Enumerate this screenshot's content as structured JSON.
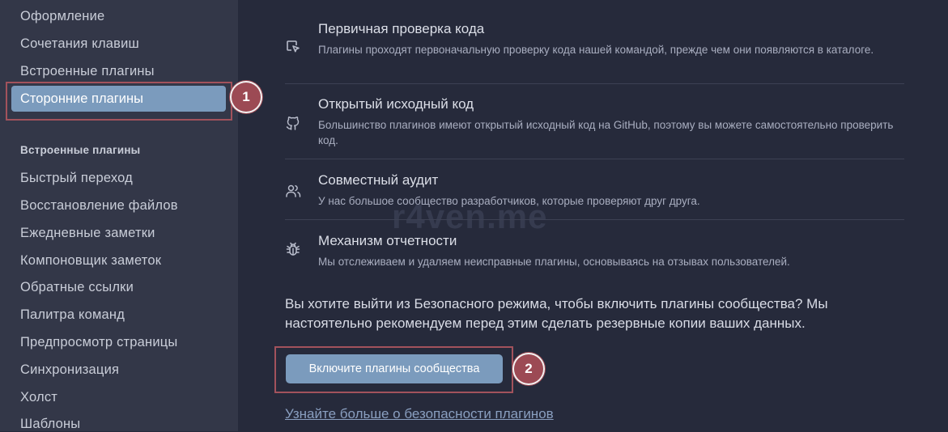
{
  "sidebar": {
    "items_top": [
      "Оформление",
      "Сочетания клавиш",
      "Встроенные плагины"
    ],
    "active_item": "Сторонние плагины",
    "section_title": "Встроенные плагины",
    "items_core": [
      "Быстрый переход",
      "Восстановление файлов",
      "Ежедневные заметки",
      "Компоновщик заметок",
      "Обратные ссылки",
      "Палитра команд",
      "Предпросмотр страницы",
      "Синхронизация",
      "Холст",
      "Шаблоны"
    ]
  },
  "annotations": {
    "badge1": "1",
    "badge2": "2",
    "highlight_color": "#a2525c"
  },
  "features": [
    {
      "icon": "cursor-select-icon",
      "title": "Первичная проверка кода",
      "desc": "Плагины проходят первоначальную проверку кода нашей командой, прежде чем они появляются в каталоге."
    },
    {
      "icon": "github-icon",
      "title": "Открытый исходный код",
      "desc": "Большинство плагинов имеют открытый исходный код на GitHub, поэтому вы можете самостоятельно проверить код."
    },
    {
      "icon": "users-icon",
      "title": "Совместный аудит",
      "desc": "У нас большое сообщество разработчиков, которые проверяют друг друга."
    },
    {
      "icon": "bug-icon",
      "title": "Механизм отчетности",
      "desc": "Мы отслеживаем и удаляем неисправные плагины, основываясь на отзывах пользователей."
    }
  ],
  "question": "Вы хотите выйти из Безопасного режима, чтобы включить плагины сообщества? Мы настоятельно рекомендуем перед этим сделать резервные копии ваших данных.",
  "enable_button": "Включите плагины сообщества",
  "learn_more_link": "Узнайте больше о безопасности плагинов",
  "watermark": "r4ven.me",
  "colors": {
    "accent": "#7b9bbd",
    "background": "#262a3b",
    "sidebar": "#333748"
  }
}
